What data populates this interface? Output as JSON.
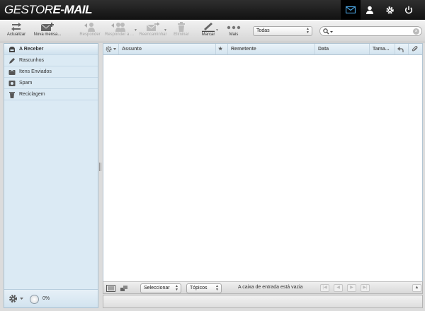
{
  "app": {
    "logo_part1": "GESTOR",
    "logo_part2": "E-MAIL"
  },
  "toolbar": {
    "refresh": "Actualizar",
    "new_message": "Nova mensa...",
    "reply": "Responder",
    "reply_all": "Responder a ...",
    "forward": "Reencaminhar",
    "delete": "Eliminar",
    "mark": "Marcar",
    "more": "Mais",
    "filter_value": "Todas"
  },
  "folders": [
    {
      "name": "A Receber",
      "icon": "inbox-icon",
      "selected": true
    },
    {
      "name": "Rascunhos",
      "icon": "pencil-icon"
    },
    {
      "name": "Itens Enviados",
      "icon": "sent-icon"
    },
    {
      "name": "Spam",
      "icon": "spam-icon"
    },
    {
      "name": "Reciclagem",
      "icon": "trash-icon"
    }
  ],
  "sidebar_footer": {
    "quota": "0%"
  },
  "columns": {
    "subject": "Assunto",
    "sender": "Remetente",
    "date": "Data",
    "size": "Tama..."
  },
  "list_footer": {
    "select_label": "Seleccionar",
    "threads_label": "Tópicos",
    "status": "A caixa de entrada está vazia"
  },
  "colors": {
    "header_bg": "#1a1a1a",
    "accent": "#4aa3df",
    "sidebar_bg": "#dbeaf4"
  }
}
